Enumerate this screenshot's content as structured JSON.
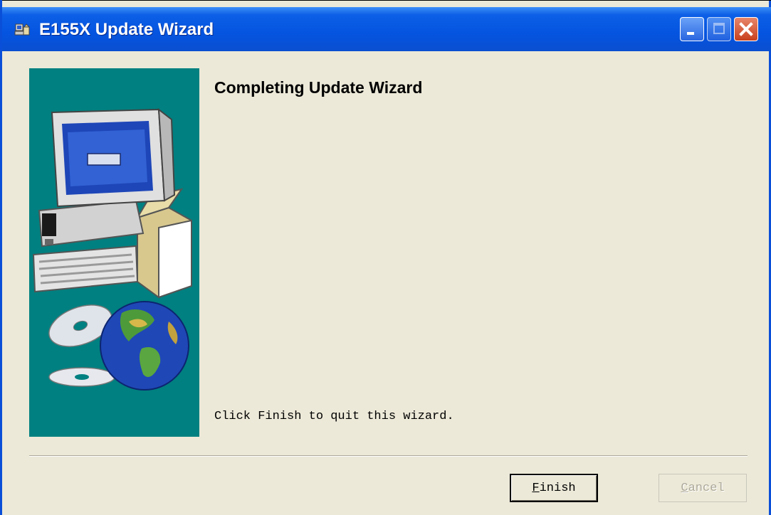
{
  "window": {
    "title": "E155X Update Wizard",
    "accent_color": "#0554e0",
    "background_color": "#ece9d8",
    "side_panel_color": "#008080",
    "icons": [
      "setup-app-icon",
      "minimize-icon",
      "maximize-icon",
      "close-icon",
      "computer-illustration",
      "cd-disc-illustration",
      "globe-illustration"
    ]
  },
  "wizard": {
    "heading": "Completing Update Wizard",
    "message": "Click Finish to quit this wizard.",
    "buttons": {
      "finish_label": "Finish",
      "cancel_label": "Cancel",
      "cancel_enabled": false
    }
  }
}
